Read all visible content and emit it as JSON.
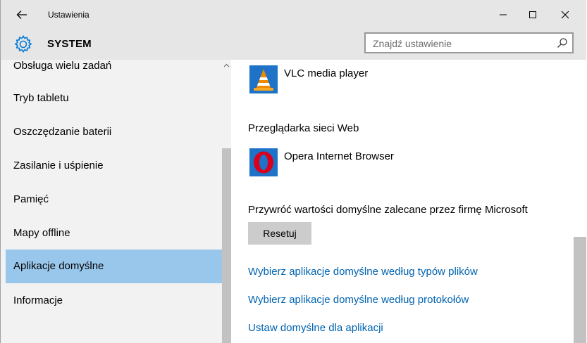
{
  "window": {
    "title": "Ustawienia"
  },
  "header": {
    "section": "SYSTEM",
    "search_placeholder": "Znajdź ustawienie"
  },
  "sidebar": {
    "items": [
      {
        "label": "Obsługa wielu zadań",
        "active": false
      },
      {
        "label": "Tryb tabletu",
        "active": false
      },
      {
        "label": "Oszczędzanie baterii",
        "active": false
      },
      {
        "label": "Zasilanie i uśpienie",
        "active": false
      },
      {
        "label": "Pamięć",
        "active": false
      },
      {
        "label": "Mapy offline",
        "active": false
      },
      {
        "label": "Aplikacje domyślne",
        "active": true
      },
      {
        "label": "Informacje",
        "active": false
      }
    ]
  },
  "content": {
    "video_app": {
      "name": "VLC media player",
      "icon": "vlc-icon"
    },
    "browser_heading": "Przeglądarka sieci Web",
    "browser_app": {
      "name": "Opera Internet Browser",
      "icon": "opera-icon"
    },
    "reset_heading": "Przywróć wartości domyślne zalecane przez firmę Microsoft",
    "reset_button": "Resetuj",
    "links": [
      "Wybierz aplikacje domyślne według typów plików",
      "Wybierz aplikacje domyślne według protokołów",
      "Ustaw domyślne dla aplikacji"
    ]
  },
  "colors": {
    "chrome": "#e6e6e6",
    "sidebar": "#f2f2f2",
    "active_item": "#99c7ec",
    "link": "#0063b1",
    "accent": "#0078d7"
  }
}
